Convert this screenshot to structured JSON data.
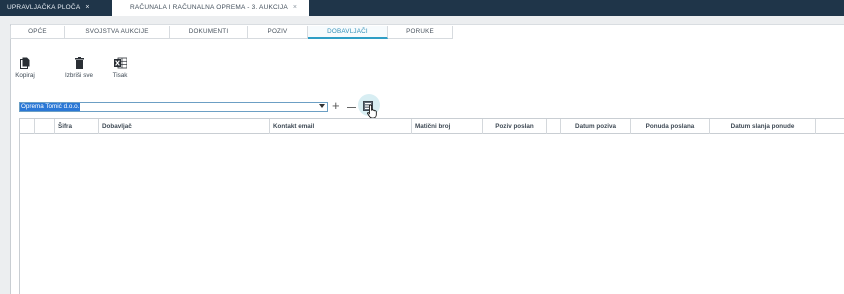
{
  "top_tabs": [
    {
      "label": "UPRAVLJAČKA PLOČA",
      "close": "×"
    },
    {
      "label": "RAČUNALA I RAČUNALNA OPREMA - 3. AUKCIJA",
      "close": "×"
    }
  ],
  "sub_tabs": [
    {
      "label": "OPĆE"
    },
    {
      "label": "SVOJSTVA AUKCIJE"
    },
    {
      "label": "DOKUMENTI"
    },
    {
      "label": "POZIV"
    },
    {
      "label": "DOBAVLJAČI",
      "active": true
    },
    {
      "label": "PORUKE"
    }
  ],
  "toolbar": {
    "copy_label": "Kopiraj",
    "delete_all_label": "Izbriši sve",
    "print_label": "Tisak"
  },
  "supplier_select": {
    "value": "Oprema Tomić d.o.o."
  },
  "grid": {
    "columns": [
      "",
      "",
      "Šifra",
      "Dobavljač",
      "Kontakt email",
      "Matični broj",
      "Poziv poslan",
      "",
      "Datum poziva",
      "Ponuda poslana",
      "Datum slanja ponude",
      ""
    ]
  },
  "colors": {
    "topbar": "#1f3549",
    "accent": "#2f9ec5",
    "selection": "#2b78d6",
    "excel_green": "#1f6e43"
  },
  "icons": [
    "copy-icon",
    "trash-icon",
    "excel-icon",
    "chevron-down-icon",
    "plus-icon",
    "minus-icon",
    "add-list-icon",
    "cursor-icon"
  ]
}
